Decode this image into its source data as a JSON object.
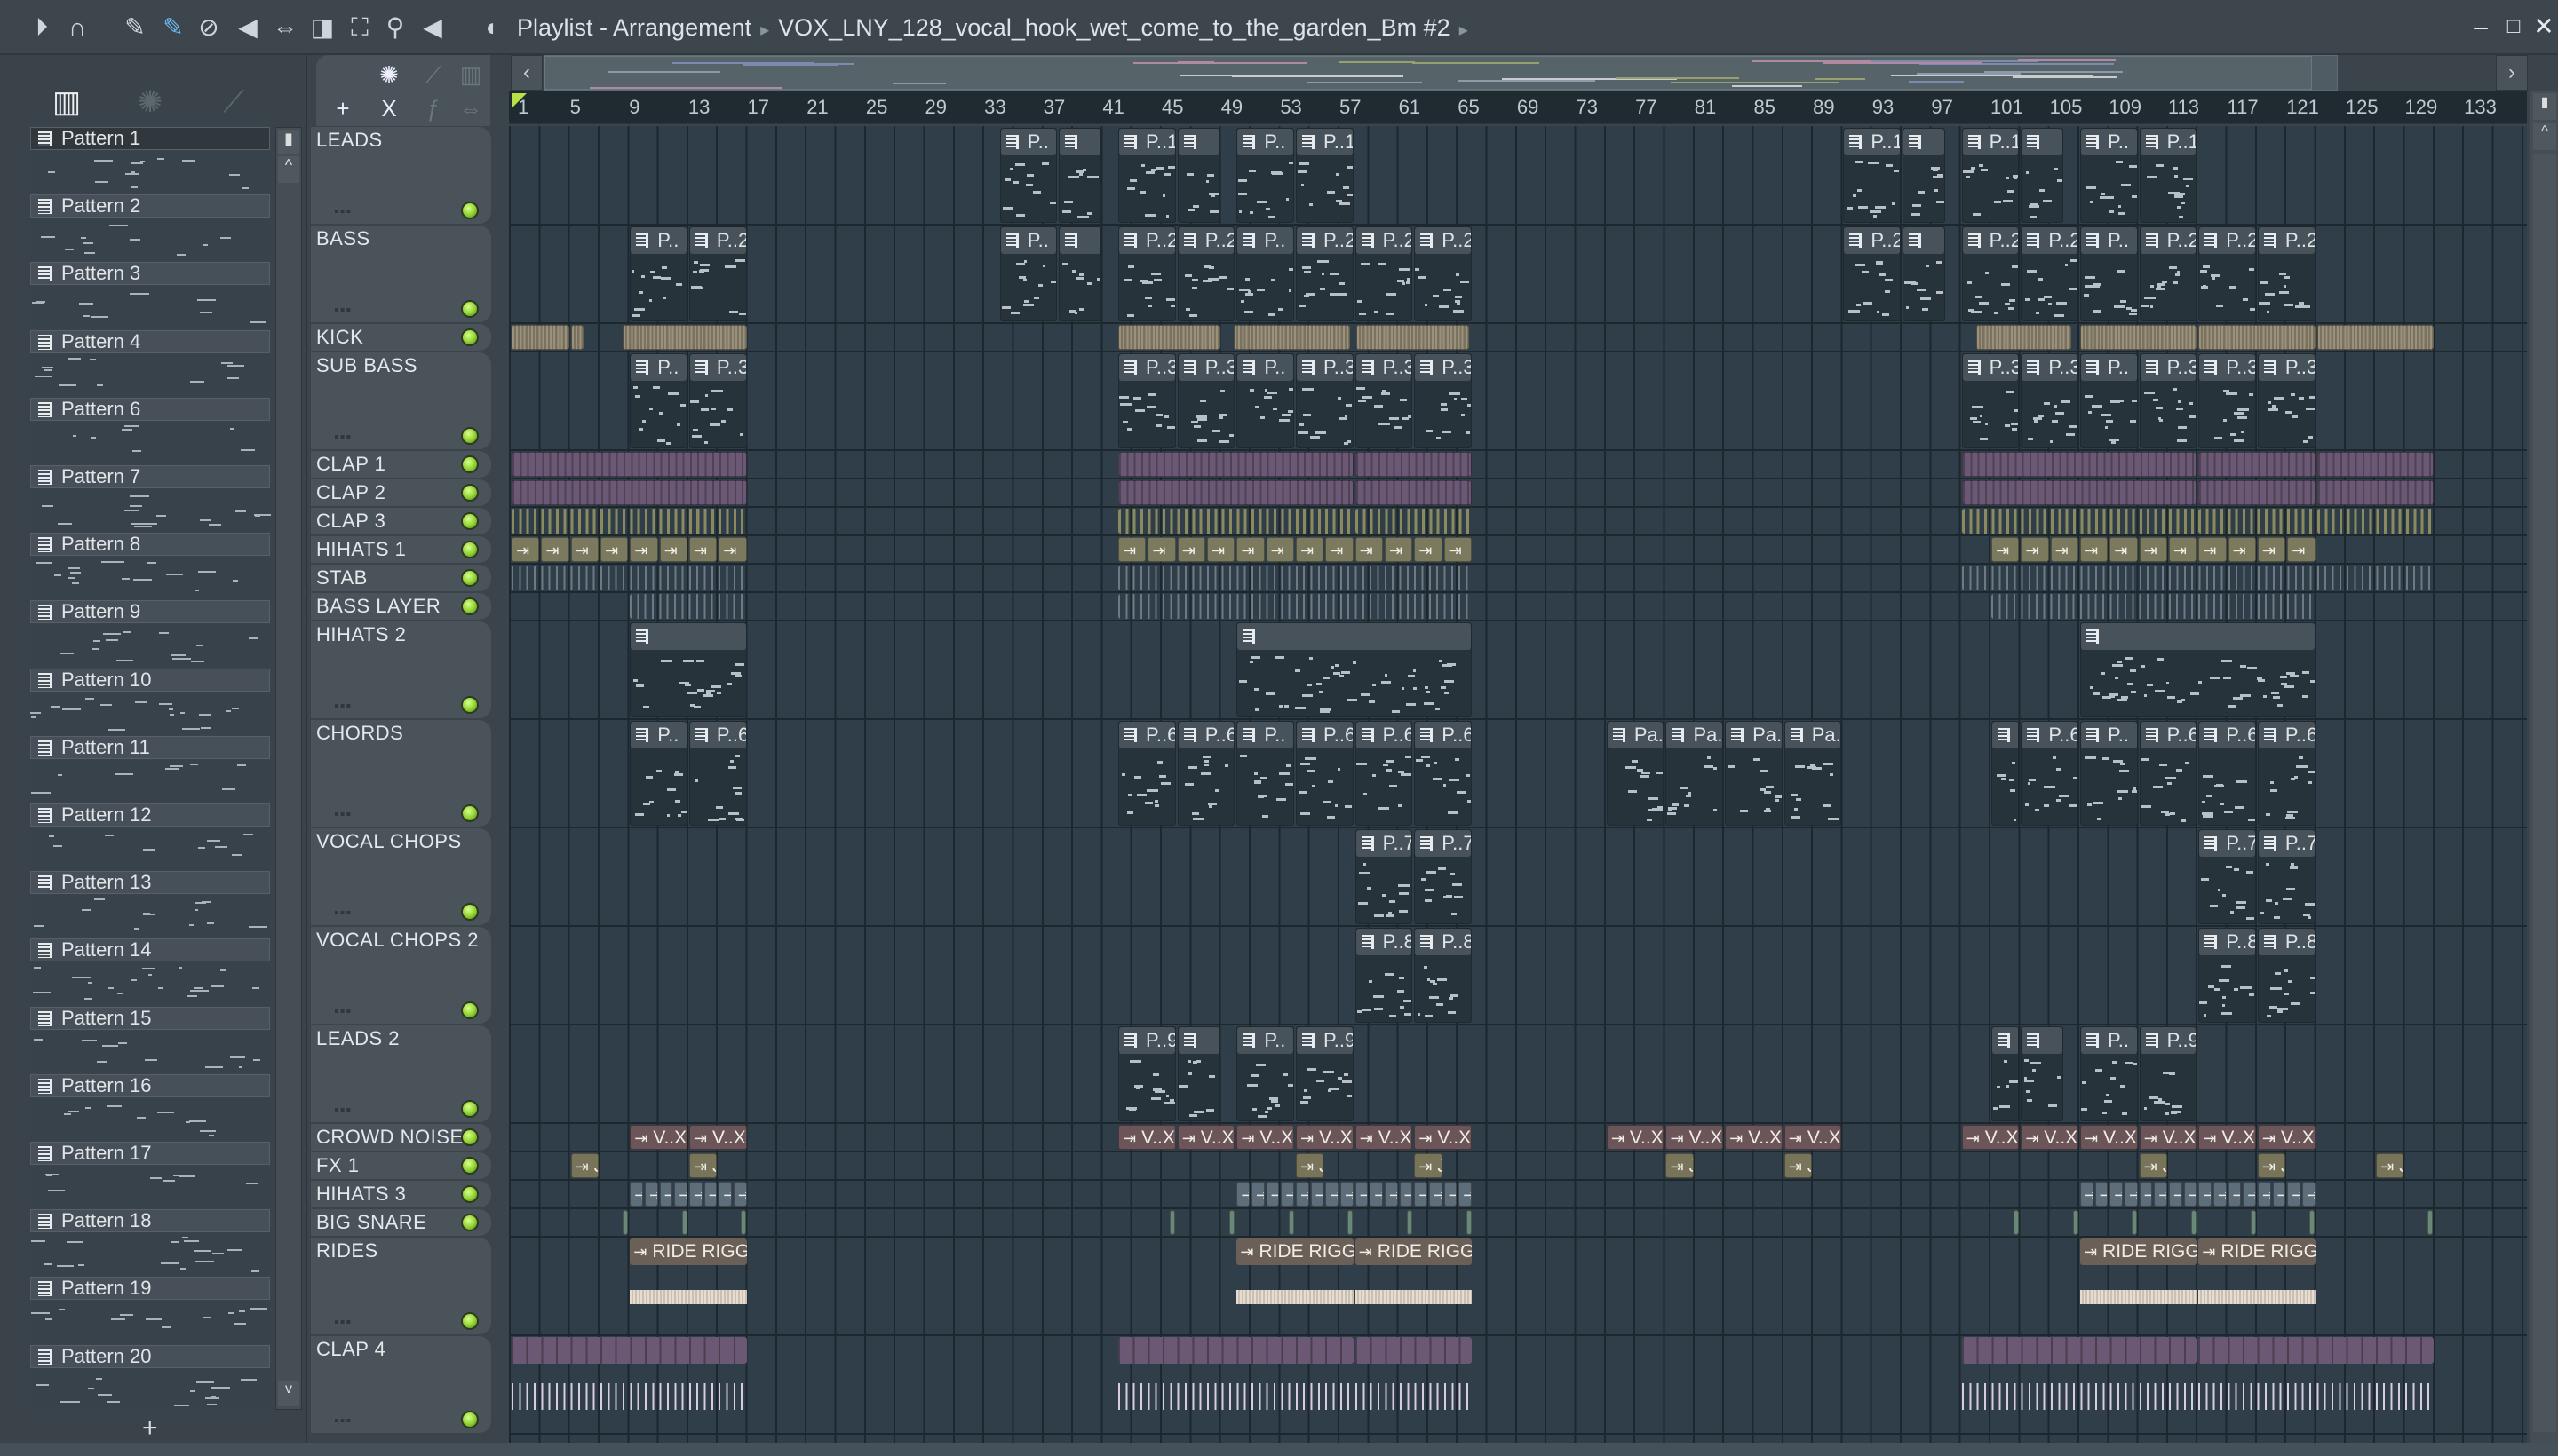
{
  "titlebar": {
    "window_title": "Playlist - Arrangement",
    "separator": "▸",
    "pattern_name": "VOX_LNY_128_vocal_hook_wet_come_to_the_garden_Bm #2",
    "tools": [
      "play-arrow",
      "magnet",
      "pencil",
      "paint",
      "delete",
      "mute",
      "slip",
      "slice",
      "select",
      "zoom",
      "playback",
      "speaker"
    ],
    "controls": {
      "minimize": "–",
      "maximize": "□",
      "close": "✕"
    }
  },
  "left_panel": {
    "add_label": "+",
    "patterns": [
      "Pattern 1",
      "Pattern 2",
      "Pattern 3",
      "Pattern 4",
      "Pattern 6",
      "Pattern 7",
      "Pattern 8",
      "Pattern 9",
      "Pattern 10",
      "Pattern 11",
      "Pattern 12",
      "Pattern 13",
      "Pattern 14",
      "Pattern 15",
      "Pattern 16",
      "Pattern 17",
      "Pattern 18",
      "Pattern 19",
      "Pattern 20"
    ],
    "selected_pattern": "Pattern 1"
  },
  "toolcol": {
    "add_track": "+",
    "x_label": "X"
  },
  "ruler": {
    "labels": [
      "1",
      "5",
      "9",
      "13",
      "17",
      "21",
      "25",
      "29",
      "33",
      "37",
      "41",
      "45",
      "49",
      "53",
      "57",
      "61",
      "65",
      "69",
      "73",
      "77",
      "81",
      "85",
      "89",
      "93",
      "97",
      "101",
      "105",
      "109",
      "113",
      "117",
      "121",
      "125",
      "129",
      "133"
    ]
  },
  "colors": {
    "grid_bg": "#2f3e48",
    "led": "#8fd030",
    "kick": "#7a7260",
    "clap": "#6a5874",
    "clap3": "#5f6044",
    "hihat": "#7c7a5e",
    "stab": "#6b7580",
    "crowd": "#6b5558",
    "fx": "#77745a",
    "hihat3": "#5e6d7a",
    "snare": "#6a8878",
    "ride": "#6b6058",
    "playhead": "#b9e04a"
  },
  "tracks": [
    {
      "name": "LEADS",
      "kind": "pattern",
      "clips": [
        [
          34,
          4,
          "P.."
        ],
        [
          38,
          3,
          ""
        ],
        [
          42,
          4,
          "P..1"
        ],
        [
          46,
          3,
          ""
        ],
        [
          50,
          4,
          "P.."
        ],
        [
          54,
          4,
          "P..1"
        ],
        [
          91,
          4,
          "P..1"
        ],
        [
          95,
          3,
          ""
        ],
        [
          99,
          4,
          "P..1"
        ],
        [
          103,
          3,
          ""
        ],
        [
          107,
          4,
          "P.."
        ],
        [
          111,
          4,
          "P..1"
        ]
      ]
    },
    {
      "name": "BASS",
      "kind": "pattern",
      "clips": [
        [
          9,
          4,
          "P.."
        ],
        [
          13,
          4,
          "P..2"
        ],
        [
          34,
          4,
          "P.."
        ],
        [
          38,
          3,
          ""
        ],
        [
          42,
          4,
          "P..2"
        ],
        [
          46,
          4,
          "P..2"
        ],
        [
          50,
          4,
          "P.."
        ],
        [
          54,
          4,
          "P..2"
        ],
        [
          58,
          4,
          "P..2"
        ],
        [
          62,
          4,
          "P..2"
        ],
        [
          91,
          4,
          "P..2"
        ],
        [
          95,
          3,
          ""
        ],
        [
          99,
          4,
          "P..2"
        ],
        [
          103,
          4,
          "P..2"
        ],
        [
          107,
          4,
          "P.."
        ],
        [
          111,
          4,
          "P..2"
        ],
        [
          115,
          4,
          "P..2"
        ],
        [
          119,
          4,
          "P..2"
        ]
      ]
    },
    {
      "name": "KICK",
      "kind": "audio",
      "color": "kick",
      "style": "dense",
      "clips": [
        [
          1,
          4,
          ""
        ],
        [
          5,
          1,
          ""
        ],
        [
          8.5,
          8.5,
          ""
        ],
        [
          42,
          7,
          ""
        ],
        [
          49.8,
          8,
          ""
        ],
        [
          58.1,
          7.7,
          ""
        ],
        [
          100,
          6.5,
          ""
        ],
        [
          107,
          8,
          ""
        ],
        [
          115,
          8,
          ""
        ],
        [
          123,
          8,
          ""
        ]
      ]
    },
    {
      "name": "SUB BASS",
      "kind": "pattern",
      "clips": [
        [
          9,
          4,
          "P.."
        ],
        [
          13,
          4,
          "P..3"
        ],
        [
          42,
          4,
          "P..3"
        ],
        [
          46,
          4,
          "P..3"
        ],
        [
          50,
          4,
          "P.."
        ],
        [
          54,
          4,
          "P..3"
        ],
        [
          58,
          4,
          "P..3"
        ],
        [
          62,
          4,
          "P..3"
        ],
        [
          99,
          4,
          "P..3"
        ],
        [
          103,
          4,
          "P..3"
        ],
        [
          107,
          4,
          "P.."
        ],
        [
          111,
          4,
          "P..3"
        ],
        [
          115,
          4,
          "P..3"
        ],
        [
          119,
          4,
          "P..3"
        ]
      ]
    },
    {
      "name": "CLAP 1",
      "kind": "audio",
      "color": "clap",
      "style": "blocks",
      "clips": [
        [
          1,
          16,
          ""
        ],
        [
          42,
          16,
          ""
        ],
        [
          58,
          8,
          ""
        ],
        [
          99,
          16,
          ""
        ],
        [
          115,
          8,
          ""
        ],
        [
          123,
          8,
          ""
        ]
      ]
    },
    {
      "name": "CLAP 2",
      "kind": "audio",
      "color": "clap",
      "style": "blocks",
      "clips": [
        [
          1,
          16,
          ""
        ],
        [
          42,
          16,
          ""
        ],
        [
          58,
          8,
          ""
        ],
        [
          99,
          16,
          ""
        ],
        [
          115,
          8,
          ""
        ],
        [
          123,
          8,
          ""
        ]
      ]
    },
    {
      "name": "CLAP 3",
      "kind": "audio",
      "color": "clap3",
      "style": "lines",
      "clips": [
        [
          1,
          16,
          ""
        ],
        [
          42,
          16,
          ""
        ],
        [
          58,
          8,
          ""
        ],
        [
          99,
          16,
          ""
        ],
        [
          115,
          8,
          ""
        ],
        [
          123,
          8,
          ""
        ]
      ]
    },
    {
      "name": "HIHATS 1",
      "kind": "audio",
      "color": "hihat",
      "style": "boxes",
      "repeat": 2,
      "clips": [
        [
          1,
          16,
          ""
        ],
        [
          42,
          16,
          ""
        ],
        [
          58,
          8,
          ""
        ],
        [
          101,
          14,
          ""
        ],
        [
          115,
          8,
          ""
        ]
      ]
    },
    {
      "name": "STAB",
      "kind": "audio",
      "color": "stab",
      "style": "ticks",
      "clips": [
        [
          1,
          16,
          ""
        ],
        [
          42,
          24,
          ""
        ],
        [
          99,
          32,
          ""
        ]
      ]
    },
    {
      "name": "BASS LAYER",
      "kind": "audio",
      "color": "stab",
      "style": "ticks",
      "clips": [
        [
          9,
          8,
          ""
        ],
        [
          42,
          24,
          ""
        ],
        [
          101,
          22,
          ""
        ]
      ]
    },
    {
      "name": "HIHATS 2",
      "kind": "pattern",
      "clips": [
        [
          9,
          8,
          ""
        ],
        [
          50,
          16,
          ""
        ],
        [
          107,
          16,
          ""
        ]
      ]
    },
    {
      "name": "CHORDS",
      "kind": "pattern",
      "clips": [
        [
          9,
          4,
          "P.."
        ],
        [
          13,
          4,
          "P..6"
        ],
        [
          42,
          4,
          "P..6"
        ],
        [
          46,
          4,
          "P..6"
        ],
        [
          50,
          4,
          "P.."
        ],
        [
          54,
          4,
          "P..6"
        ],
        [
          58,
          4,
          "P..6"
        ],
        [
          62,
          4,
          "P..6"
        ],
        [
          75,
          4,
          "Pa.."
        ],
        [
          79,
          4,
          "Pa.."
        ],
        [
          83,
          4,
          "Pa.."
        ],
        [
          87,
          4,
          "Pa.."
        ],
        [
          101,
          2,
          ""
        ],
        [
          103,
          4,
          "P..6"
        ],
        [
          107,
          4,
          "P.."
        ],
        [
          111,
          4,
          "P..6"
        ],
        [
          115,
          4,
          "P..6"
        ],
        [
          119,
          4,
          "P..6"
        ]
      ]
    },
    {
      "name": "VOCAL CHOPS",
      "kind": "pattern",
      "clips": [
        [
          58,
          4,
          "P..7"
        ],
        [
          62,
          4,
          "P..7"
        ],
        [
          115,
          4,
          "P..7"
        ],
        [
          119,
          4,
          "P..7"
        ]
      ]
    },
    {
      "name": "VOCAL CHOPS 2",
      "kind": "pattern",
      "clips": [
        [
          58,
          4,
          "P..8"
        ],
        [
          62,
          4,
          "P..8"
        ],
        [
          115,
          4,
          "P..8"
        ],
        [
          119,
          4,
          "P..8"
        ]
      ]
    },
    {
      "name": "LEADS 2",
      "kind": "pattern",
      "clips": [
        [
          42,
          4,
          "P..9"
        ],
        [
          46,
          3,
          ""
        ],
        [
          50,
          4,
          "P.."
        ],
        [
          54,
          4,
          "P..9"
        ],
        [
          101,
          2,
          ""
        ],
        [
          103,
          3,
          ""
        ],
        [
          107,
          4,
          "P.."
        ],
        [
          111,
          4,
          "P..9"
        ]
      ]
    },
    {
      "name": "CROWD NOISE",
      "kind": "audio",
      "color": "crowd",
      "style": "label",
      "clips": [
        [
          9,
          4,
          "V..X"
        ],
        [
          13,
          4,
          "V..X"
        ],
        [
          42,
          4,
          "V..X"
        ],
        [
          46,
          4,
          "V..X"
        ],
        [
          50,
          4,
          "V..X"
        ],
        [
          54,
          4,
          "V..X"
        ],
        [
          58,
          4,
          "V..X"
        ],
        [
          62,
          4,
          "V..X"
        ],
        [
          75,
          4,
          "V..X"
        ],
        [
          79,
          4,
          "V..X"
        ],
        [
          83,
          4,
          "V..X"
        ],
        [
          87,
          4,
          "V..X"
        ],
        [
          99,
          4,
          "V..X"
        ],
        [
          103,
          4,
          "V..X"
        ],
        [
          107,
          4,
          "V..X"
        ],
        [
          111,
          4,
          "V..X"
        ],
        [
          115,
          4,
          "V..X"
        ],
        [
          119,
          4,
          "V..X"
        ]
      ]
    },
    {
      "name": "FX 1",
      "kind": "audio",
      "color": "fx",
      "style": "label",
      "clips": [
        [
          5,
          2,
          "Ja.."
        ],
        [
          13,
          2,
          "Ja.."
        ],
        [
          54,
          2,
          "Ja.."
        ],
        [
          62,
          2,
          "Ja.."
        ],
        [
          79,
          2,
          "Ja.."
        ],
        [
          87,
          2,
          "Ja.."
        ],
        [
          111,
          2,
          "Ja.."
        ],
        [
          119,
          2,
          "Ja.."
        ],
        [
          127,
          2,
          "Ja.."
        ]
      ]
    },
    {
      "name": "HIHATS 3",
      "kind": "audio",
      "color": "hihat3",
      "style": "boxes",
      "repeat": 1,
      "clips": [
        [
          9,
          8,
          ""
        ],
        [
          50,
          16,
          ""
        ],
        [
          107,
          16,
          ""
        ]
      ]
    },
    {
      "name": "BIG SNARE",
      "kind": "audio",
      "color": "snare",
      "style": "plain",
      "clips": [
        [
          8.5,
          0.4,
          ""
        ],
        [
          12.5,
          0.4,
          ""
        ],
        [
          16.5,
          0.4,
          ""
        ],
        [
          45.5,
          0.4,
          ""
        ],
        [
          49.5,
          0.4,
          ""
        ],
        [
          53.5,
          0.4,
          ""
        ],
        [
          57.5,
          0.4,
          ""
        ],
        [
          61.5,
          0.4,
          ""
        ],
        [
          65.5,
          0.4,
          ""
        ],
        [
          102.5,
          0.4,
          ""
        ],
        [
          106.5,
          0.4,
          ""
        ],
        [
          110.5,
          0.4,
          ""
        ],
        [
          114.5,
          0.4,
          ""
        ],
        [
          118.5,
          0.4,
          ""
        ],
        [
          122.5,
          0.4,
          ""
        ],
        [
          130.5,
          0.4,
          ""
        ]
      ]
    },
    {
      "name": "RIDES",
      "kind": "audio",
      "color": "ride",
      "style": "ride",
      "clips": [
        [
          9,
          8,
          "RIDE RIGGO"
        ],
        [
          50,
          8,
          "RIDE RIGGO"
        ],
        [
          58,
          8,
          "RIDE RIGGO"
        ],
        [
          107,
          8,
          "RIDE RIGGO"
        ],
        [
          115,
          8,
          "RIDE RIGGO"
        ]
      ]
    },
    {
      "name": "CLAP 4",
      "kind": "audio",
      "color": "clap",
      "style": "clap4",
      "clips": [
        [
          1,
          16,
          ""
        ],
        [
          42,
          16,
          ""
        ],
        [
          58,
          8,
          ""
        ],
        [
          99,
          16,
          ""
        ],
        [
          115,
          16,
          ""
        ]
      ]
    }
  ]
}
